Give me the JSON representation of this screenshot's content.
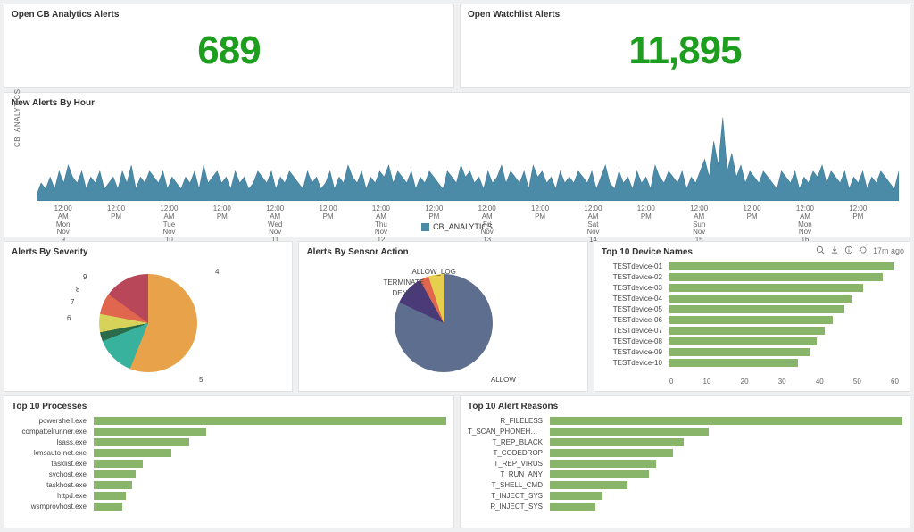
{
  "kpi": {
    "cb_title": "Open CB Analytics Alerts",
    "cb_value": "689",
    "wl_title": "Open Watchlist Alerts",
    "wl_value": "11,895"
  },
  "line_panel": {
    "title": "New Alerts By Hour",
    "ylabel": "CB_ANALYTICS",
    "legend": "CB_ANALYTICS"
  },
  "severity_panel": {
    "title": "Alerts By Severity"
  },
  "sensor_panel": {
    "title": "Alerts By Sensor Action"
  },
  "devices_panel": {
    "title": "Top 10 Device Names"
  },
  "processes_panel": {
    "title": "Top 10 Processes"
  },
  "reasons_panel": {
    "title": "Top 10 Alert Reasons"
  },
  "refresh_text": "17m ago",
  "pie_labels": {
    "sev_4": "4",
    "sev_5": "5",
    "sev_6": "6",
    "sev_7": "7",
    "sev_8": "8",
    "sev_9": "9",
    "allow": "ALLOW",
    "allow_log": "ALLOW_LOG",
    "terminate": "TERMINATE",
    "deny": "DENY"
  },
  "chart_data": [
    {
      "type": "area",
      "title": "New Alerts By Hour",
      "series_name": "CB_ANALYTICS",
      "ylabel": "CB_ANALYTICS",
      "ylim": [
        0,
        15
      ],
      "yticks": [
        5,
        10,
        15
      ],
      "x_ticks": [
        "12:00 AM Mon Nov 9 2020",
        "12:00 PM",
        "12:00 AM Tue Nov 10",
        "12:00 PM",
        "12:00 AM Wed Nov 11",
        "12:00 PM",
        "12:00 AM Thu Nov 12",
        "12:00 PM",
        "12:00 AM Fri Nov 13",
        "12:00 PM",
        "12:00 AM Sat Nov 14",
        "12:00 PM",
        "12:00 AM Sun Nov 15",
        "12:00 PM",
        "12:00 AM Mon Nov 16",
        "12:00 PM"
      ],
      "values": [
        1,
        3,
        2,
        4,
        2,
        5,
        3,
        6,
        4,
        3,
        5,
        2,
        4,
        3,
        5,
        2,
        3,
        4,
        2,
        5,
        3,
        6,
        2,
        4,
        3,
        5,
        4,
        3,
        5,
        2,
        4,
        3,
        2,
        4,
        3,
        5,
        2,
        6,
        3,
        4,
        5,
        3,
        4,
        2,
        5,
        3,
        4,
        2,
        3,
        5,
        4,
        3,
        5,
        2,
        4,
        3,
        5,
        4,
        3,
        2,
        5,
        3,
        4,
        2,
        3,
        5,
        2,
        4,
        3,
        6,
        4,
        3,
        5,
        2,
        4,
        3,
        5,
        4,
        6,
        3,
        5,
        4,
        3,
        5,
        2,
        4,
        3,
        5,
        4,
        3,
        2,
        5,
        4,
        3,
        6,
        4,
        5,
        3,
        4,
        2,
        5,
        3,
        4,
        6,
        3,
        5,
        4,
        3,
        5,
        2,
        6,
        4,
        5,
        3,
        4,
        2,
        5,
        3,
        4,
        3,
        5,
        4,
        3,
        5,
        2,
        4,
        6,
        3,
        2,
        5,
        3,
        4,
        2,
        5,
        3,
        4,
        2,
        6,
        4,
        3,
        5,
        4,
        3,
        5,
        2,
        4,
        3,
        5,
        7,
        4,
        10,
        6,
        14,
        5,
        8,
        4,
        6,
        3,
        5,
        4,
        3,
        5,
        4,
        3,
        2,
        5,
        4,
        3,
        5,
        2,
        4,
        3,
        5,
        4,
        6,
        3,
        5,
        4,
        3,
        5,
        2,
        4,
        3,
        5,
        2,
        4,
        3,
        5,
        4,
        3,
        2,
        5
      ]
    },
    {
      "type": "pie",
      "title": "Alerts By Severity",
      "slices": [
        {
          "label": "5",
          "value": 56,
          "color": "#e8a24a"
        },
        {
          "label": "4",
          "value": 13,
          "color": "#39b29d"
        },
        {
          "label": "9",
          "value": 3,
          "color": "#2b6b4a"
        },
        {
          "label": "8",
          "value": 6,
          "color": "#d7d35a"
        },
        {
          "label": "7",
          "value": 7,
          "color": "#e0674e"
        },
        {
          "label": "6",
          "value": 15,
          "color": "#b8475a"
        }
      ]
    },
    {
      "type": "pie",
      "title": "Alerts By Sensor Action",
      "slices": [
        {
          "label": "ALLOW",
          "value": 82,
          "color": "#5d6e8e"
        },
        {
          "label": "ALLOW_LOG",
          "value": 10,
          "color": "#4a3a78"
        },
        {
          "label": "TERMINATE",
          "value": 3,
          "color": "#e0674e"
        },
        {
          "label": "DENY",
          "value": 5,
          "color": "#e6cf4f"
        }
      ]
    },
    {
      "type": "bar",
      "orientation": "horizontal",
      "title": "Top 10 Device Names",
      "categories": [
        "TESTdevice-01",
        "TESTdevice-02",
        "TESTdevice-03",
        "TESTdevice-04",
        "TESTdevice-05",
        "TESTdevice-06",
        "TESTdevice-07",
        "TESTdevice-08",
        "TESTdevice-09",
        "TESTdevice-10"
      ],
      "values": [
        58,
        55,
        50,
        47,
        45,
        42,
        40,
        38,
        36,
        33
      ],
      "xlim": [
        0,
        60
      ],
      "xticks": [
        0,
        10,
        20,
        30,
        40,
        50,
        60
      ]
    },
    {
      "type": "bar",
      "orientation": "horizontal",
      "title": "Top 10 Processes",
      "categories": [
        "powershell.exe",
        "compattelrunner.exe",
        "lsass.exe",
        "kmsauto-net.exe",
        "tasklist.exe",
        "svchost.exe",
        "taskhost.exe",
        "httpd.exe",
        "wsmprovhost.exe"
      ],
      "values": [
        100,
        32,
        27,
        22,
        14,
        12,
        11,
        9,
        8
      ],
      "xlim": [
        0,
        100
      ]
    },
    {
      "type": "bar",
      "orientation": "horizontal",
      "title": "Top 10 Alert Reasons",
      "categories": [
        "R_FILELESS",
        "T_SCAN_PHONEHOME",
        "T_REP_BLACK",
        "T_CODEDROP",
        "T_REP_VIRUS",
        "T_RUN_ANY",
        "T_SHELL_CMD",
        "T_INJECT_SYS",
        "R_INJECT_SYS"
      ],
      "values": [
        100,
        45,
        38,
        35,
        30,
        28,
        22,
        15,
        13
      ],
      "xlim": [
        0,
        100
      ]
    }
  ]
}
